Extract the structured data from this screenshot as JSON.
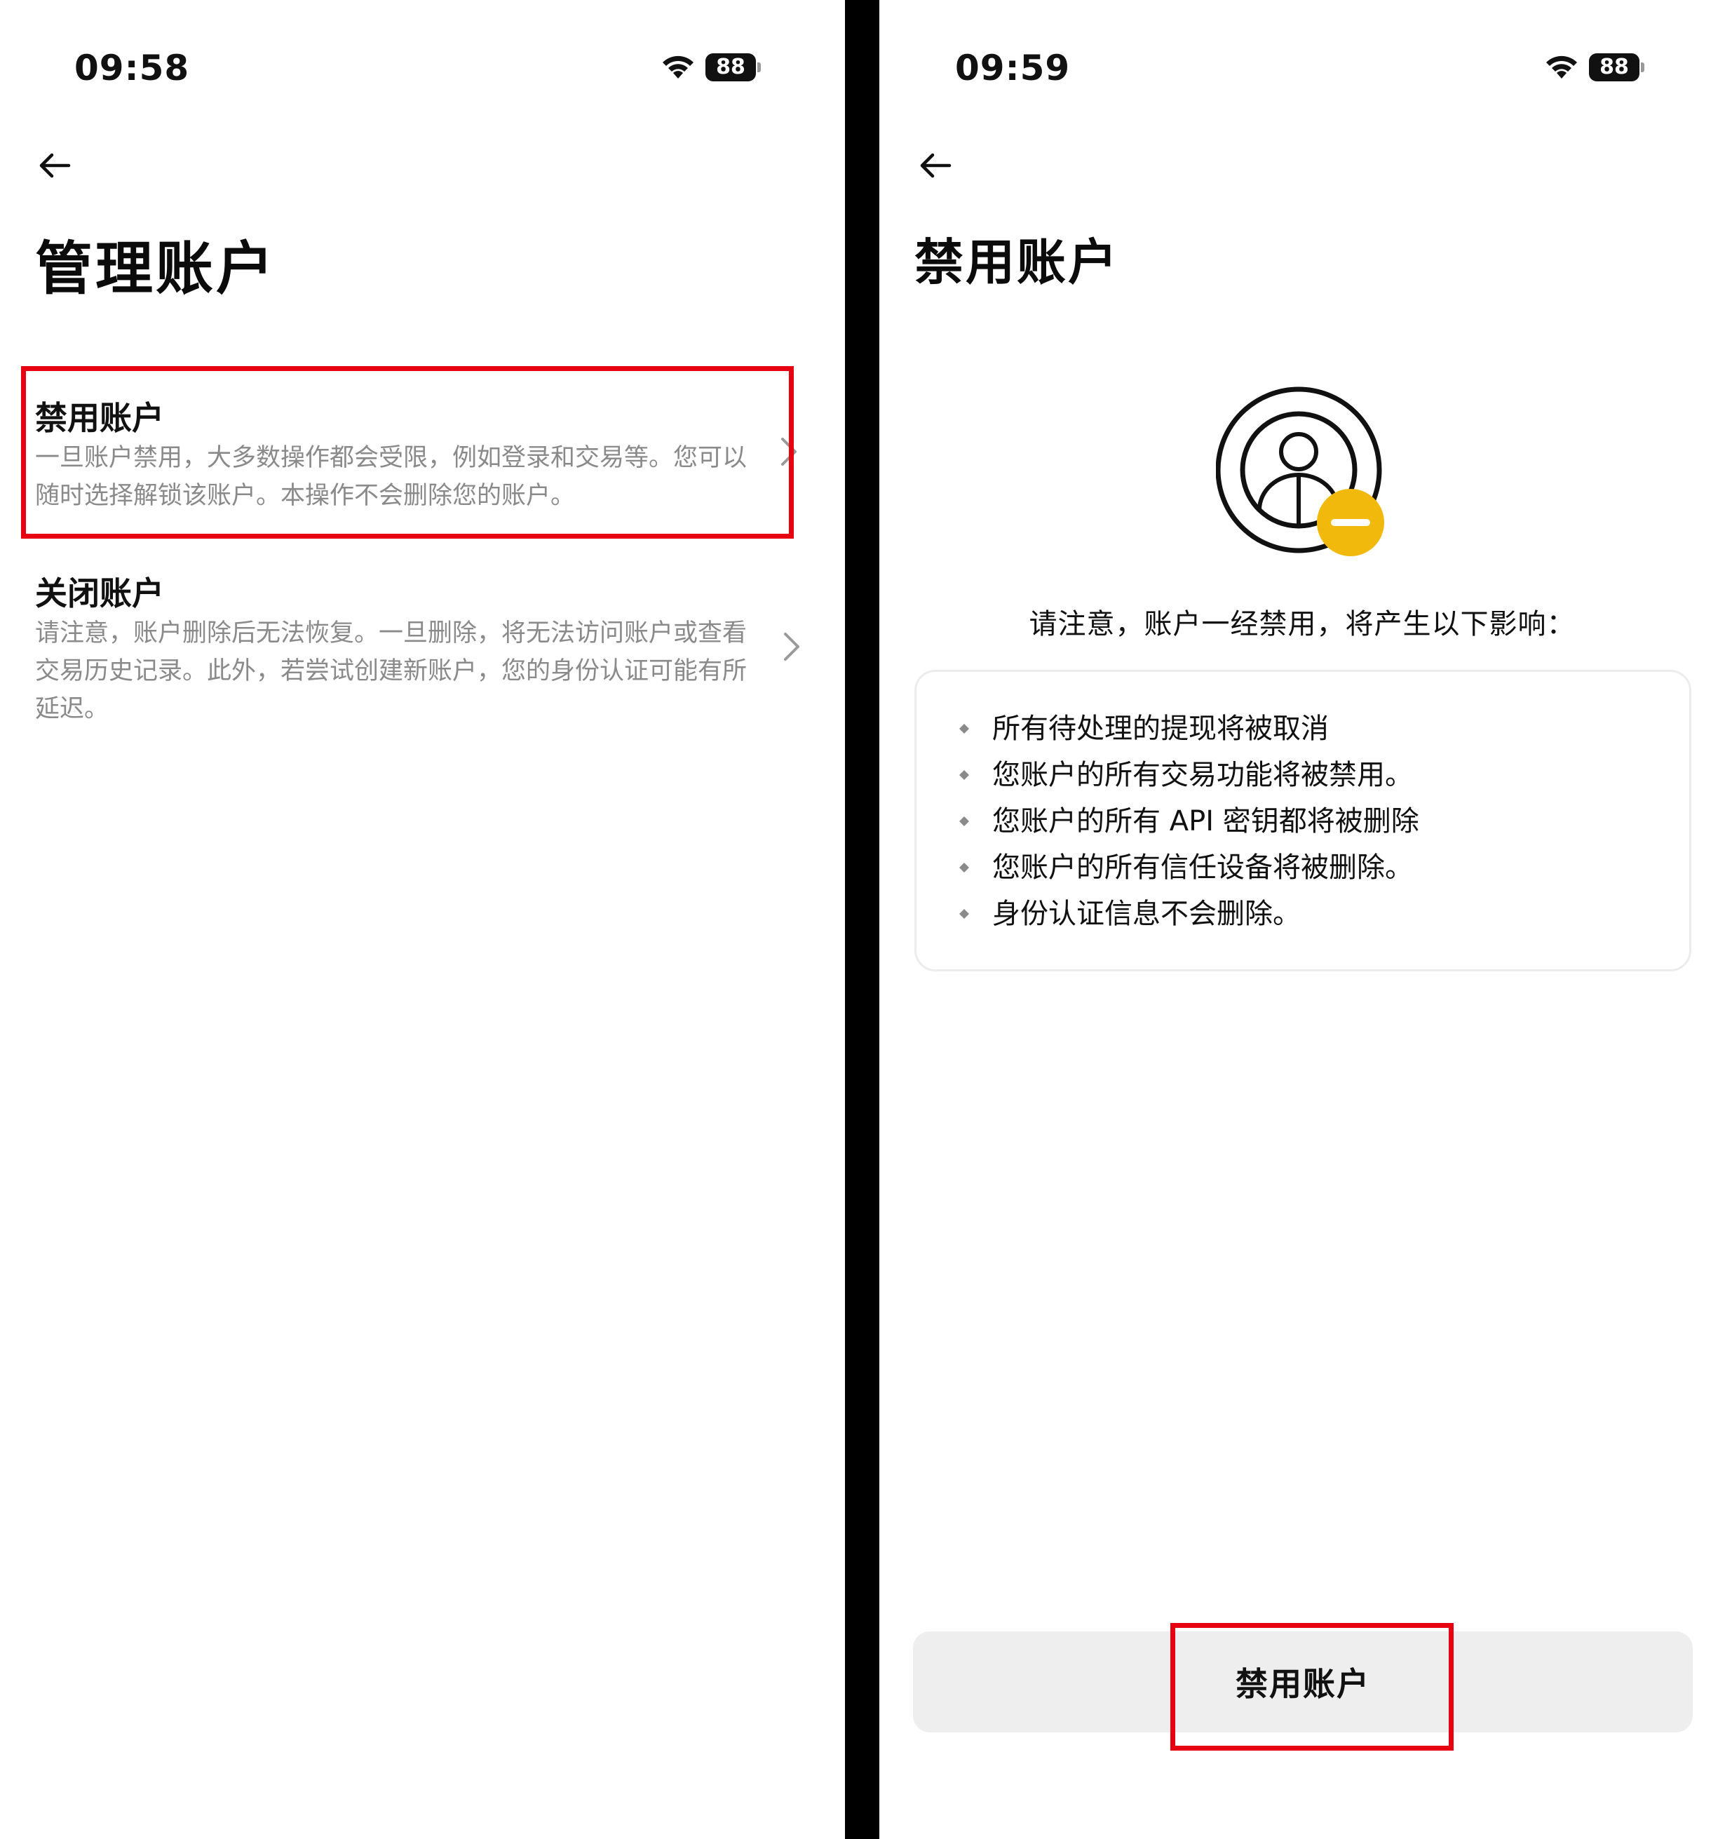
{
  "left_screen": {
    "status_bar": {
      "time": "09:58",
      "battery": "88"
    },
    "page_title": "管理账户",
    "options": [
      {
        "title": "禁用账户",
        "description": "一旦账户禁用，大多数操作都会受限，例如登录和交易等。您可以随时选择解锁该账户。本操作不会删除您的账户。"
      },
      {
        "title": "关闭账户",
        "description": "请注意，账户删除后无法恢复。一旦删除，将无法访问账户或查看交易历史记录。此外，若尝试创建新账户，您的身份认证可能有所延迟。"
      }
    ]
  },
  "right_screen": {
    "status_bar": {
      "time": "09:59",
      "battery": "88"
    },
    "page_title": "禁用账户",
    "notice": "请注意，账户一经禁用，将产生以下影响：",
    "effects": [
      "所有待处理的提现将被取消",
      "您账户的所有交易功能将被禁用。",
      "您账户的所有 API 密钥都将被删除",
      "您账户的所有信任设备将被删除。",
      "身份认证信息不会删除。"
    ],
    "button_label": "禁用账户"
  },
  "colors": {
    "highlight": "#e60012",
    "badge_yellow": "#f0b90b",
    "text_primary": "#111111",
    "text_secondary": "#8a8a8a",
    "button_bg": "#eeeeee"
  },
  "icons": {
    "back": "arrow-left-icon",
    "wifi": "wifi-icon",
    "battery": "battery-icon",
    "chevron": "chevron-right-icon",
    "avatar": "user-disabled-icon",
    "bullet": "diamond-bullet-icon"
  }
}
